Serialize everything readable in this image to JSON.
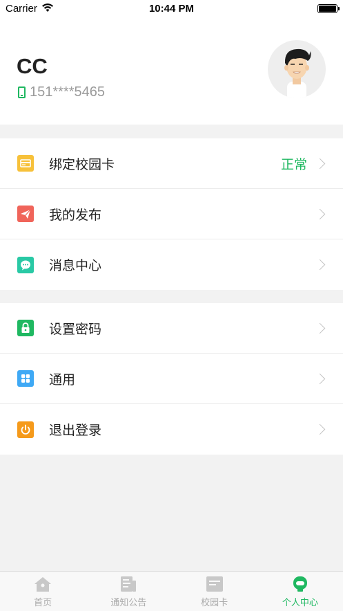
{
  "status_bar": {
    "carrier": "Carrier",
    "time": "10:44 PM"
  },
  "profile": {
    "name": "CC",
    "phone": "151****5465"
  },
  "menu_group_1": [
    {
      "label": "绑定校园卡",
      "status": "正常",
      "icon": "card-icon",
      "color": "#f7c13a"
    },
    {
      "label": "我的发布",
      "icon": "paper-plane-icon",
      "color": "#f0645a"
    },
    {
      "label": "消息中心",
      "icon": "chat-icon",
      "color": "#29c9a5"
    }
  ],
  "menu_group_2": [
    {
      "label": "设置密码",
      "icon": "lock-icon",
      "color": "#1fb861"
    },
    {
      "label": "通用",
      "icon": "grid-icon",
      "color": "#3fa9f5"
    },
    {
      "label": "退出登录",
      "icon": "power-icon",
      "color": "#f59a1b"
    }
  ],
  "tabbar": {
    "tabs": [
      {
        "label": "首页",
        "icon": "home-icon"
      },
      {
        "label": "通知公告",
        "icon": "notice-icon"
      },
      {
        "label": "校园卡",
        "icon": "campus-card-icon"
      },
      {
        "label": "个人中心",
        "icon": "profile-icon"
      }
    ],
    "active_index": 3,
    "active_color": "#1fb861"
  }
}
